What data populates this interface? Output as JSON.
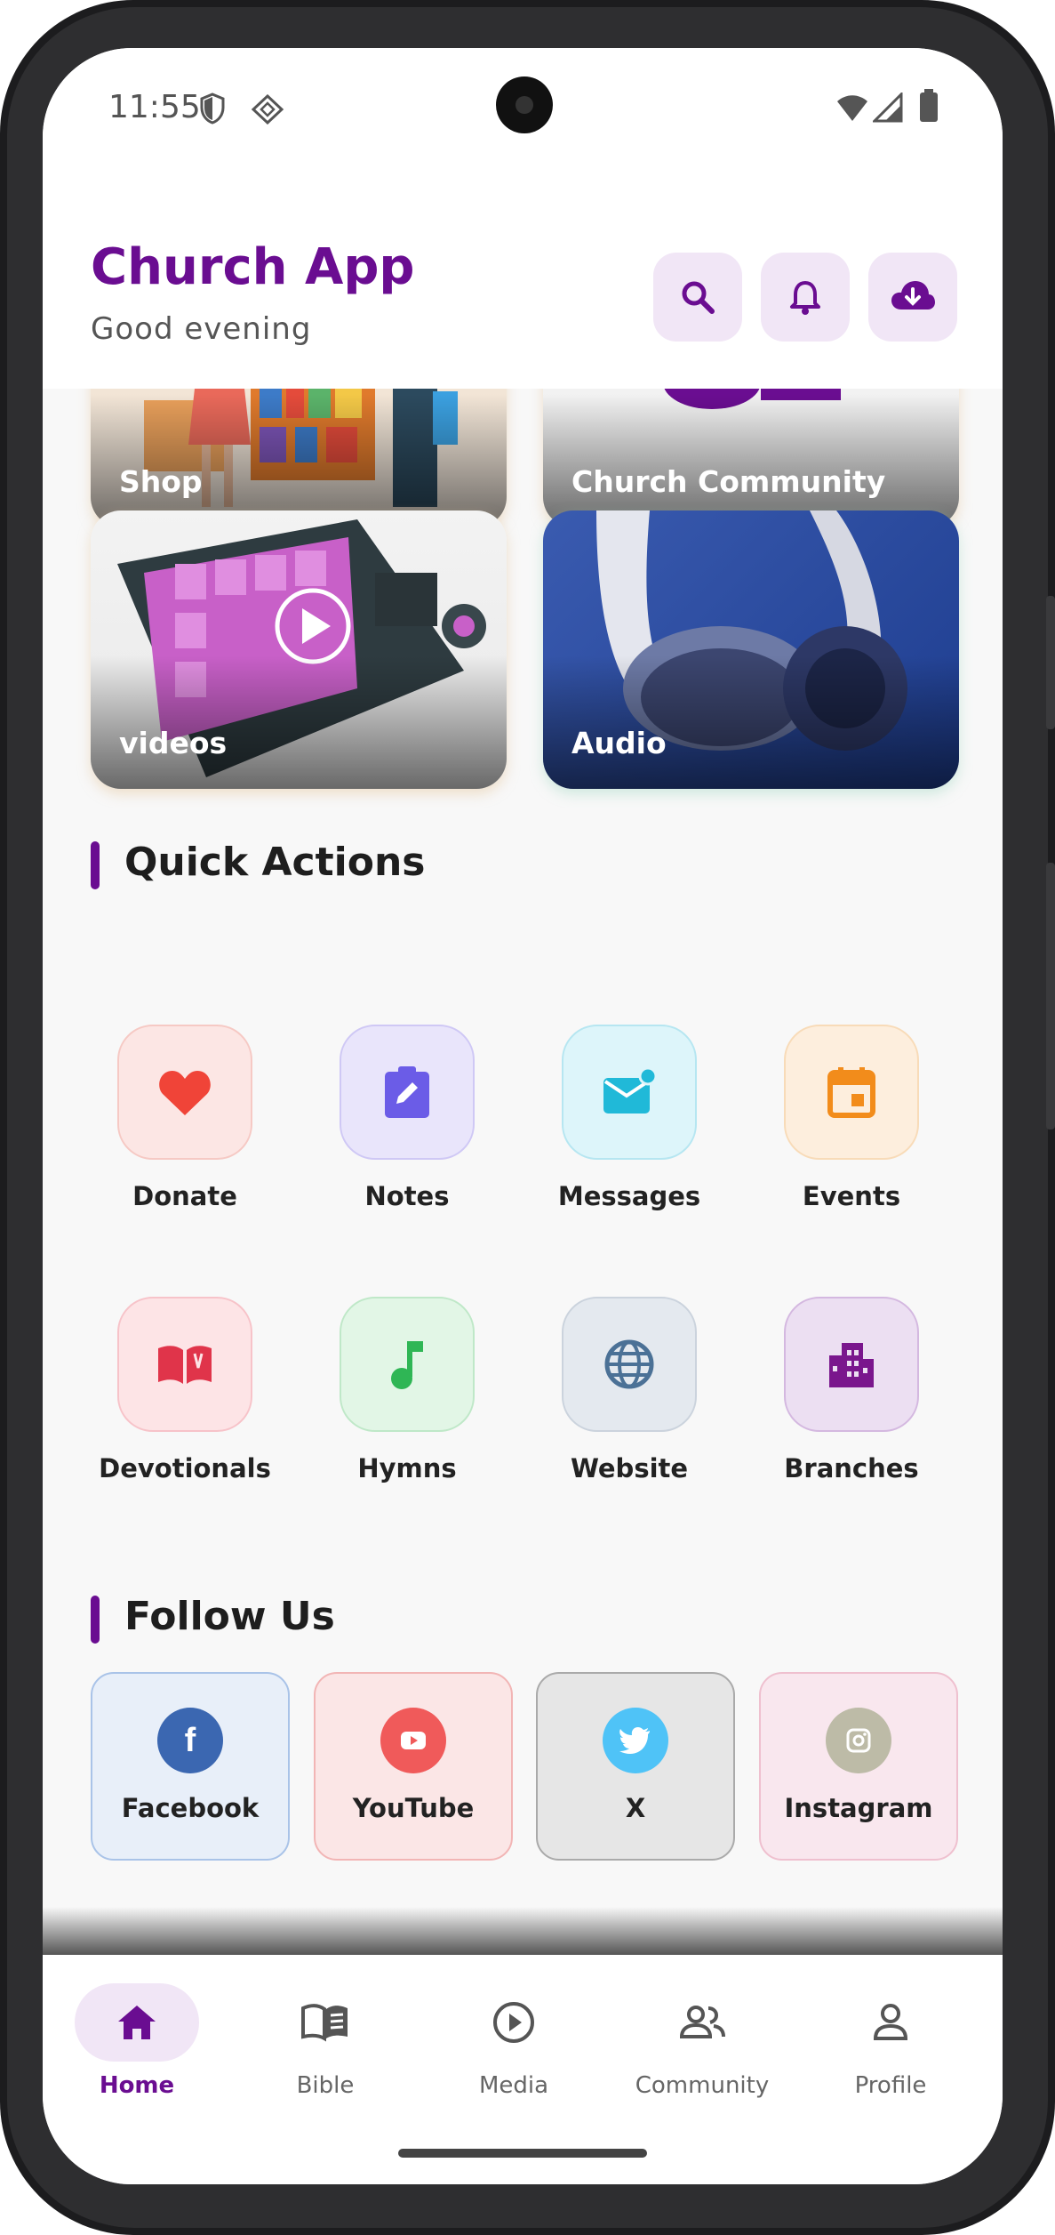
{
  "status_bar": {
    "time": "11:55"
  },
  "header": {
    "title": "Church App",
    "subtitle": "Good evening"
  },
  "feature_cards": [
    {
      "label": "Shop"
    },
    {
      "label": "Church Community"
    },
    {
      "label": "videos"
    },
    {
      "label": "Audio"
    }
  ],
  "quick_actions": {
    "title": "Quick Actions",
    "items": [
      {
        "label": "Donate",
        "icon": "heart-icon",
        "color": "#f04438"
      },
      {
        "label": "Notes",
        "icon": "edit-note-icon",
        "color": "#6b5ce7"
      },
      {
        "label": "Messages",
        "icon": "mail-icon",
        "color": "#20b9d8"
      },
      {
        "label": "Events",
        "icon": "calendar-icon",
        "color": "#f28c1b"
      },
      {
        "label": "Devotionals",
        "icon": "book-icon",
        "color": "#e0344a"
      },
      {
        "label": "Hymns",
        "icon": "music-note-icon",
        "color": "#2fb655"
      },
      {
        "label": "Website",
        "icon": "globe-icon",
        "color": "#4b7196"
      },
      {
        "label": "Branches",
        "icon": "building-icon",
        "color": "#7a168d"
      }
    ]
  },
  "follow_us": {
    "title": "Follow Us",
    "items": [
      {
        "label": "Facebook",
        "icon": "facebook-icon",
        "color": "#3b67b1"
      },
      {
        "label": "YouTube",
        "icon": "youtube-icon",
        "color": "#f05a5a"
      },
      {
        "label": "X",
        "icon": "twitter-bird-icon",
        "color": "#4fc3f7"
      },
      {
        "label": "Instagram",
        "icon": "instagram-icon",
        "color": "#bdbba7"
      }
    ]
  },
  "bottom_nav": {
    "items": [
      {
        "label": "Home",
        "icon": "home-icon",
        "active": true
      },
      {
        "label": "Bible",
        "icon": "book-open-icon",
        "active": false
      },
      {
        "label": "Media",
        "icon": "play-circle-icon",
        "active": false
      },
      {
        "label": "Community",
        "icon": "people-icon",
        "active": false
      },
      {
        "label": "Profile",
        "icon": "person-icon",
        "active": false
      }
    ]
  },
  "colors": {
    "brand": "#6a0d91",
    "accent_bg": "#f1e6f6"
  }
}
